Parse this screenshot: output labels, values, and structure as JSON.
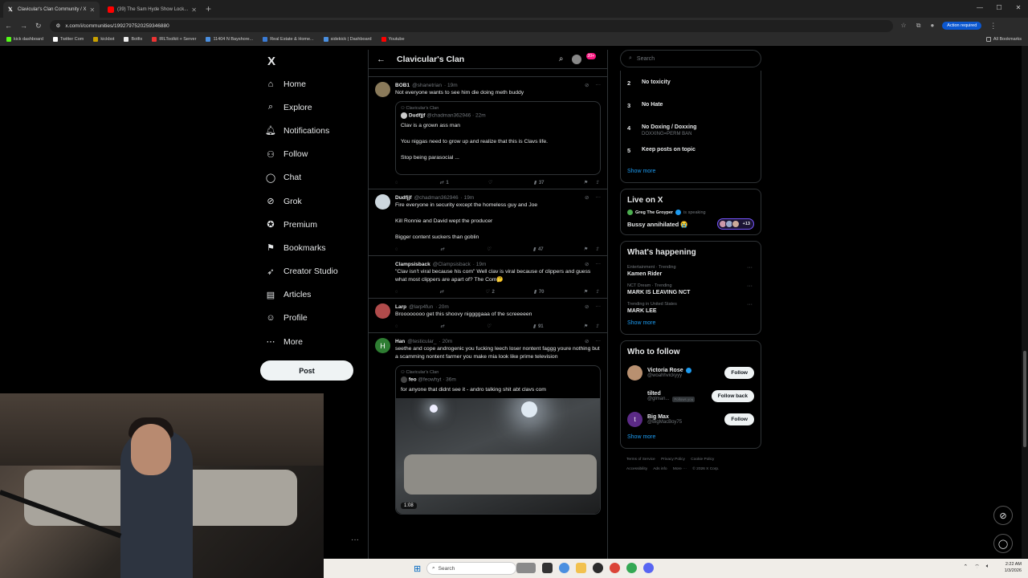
{
  "browser": {
    "tabs": [
      {
        "title": "Clavicular's Clan Community / X",
        "active": true
      },
      {
        "title": "(39) The Sam Hyde Show Lock...",
        "active": false
      }
    ],
    "new_tab": "+",
    "url": "x.com/i/communities/1992797520259346880",
    "action_required": "Action required",
    "bookmarks": [
      "kick dashboard",
      "Twitter Com",
      "kickbot",
      "Botfix",
      "IRLToolkit + Server",
      "11404 N Bayshore...",
      "Real Estate & Home...",
      "sidekick | Dashboard",
      "Youtube"
    ],
    "all_bookmarks": "All Bookmarks"
  },
  "nav": {
    "logo": "X",
    "items": [
      "Home",
      "Explore",
      "Notifications",
      "Follow",
      "Chat",
      "Grok",
      "Premium",
      "Bookmarks",
      "Creator Studio",
      "Articles",
      "Profile",
      "More"
    ],
    "post": "Post",
    "more_dots": "···"
  },
  "feed": {
    "title": "Clavicular's Clan",
    "badge": "20+",
    "tweets": [
      {
        "name": "BOB1",
        "handle": "@shanetrian",
        "time": "· 19m",
        "text": [
          "Not everyone wants to see him die doing meth buddy"
        ],
        "quote": {
          "community": "Clavicular's Clan",
          "name": "Dudfjjf",
          "handle": "@chadman362946",
          "time": "· 22m",
          "text": [
            "Clav is a grown ass man",
            "You niggas need to grow up and realize that this is Clavs life.",
            "Stop being parasocial ..."
          ]
        },
        "actions": {
          "reply": "",
          "repost": "1",
          "like": "",
          "views": "37"
        }
      },
      {
        "name": "Dudfjjf",
        "handle": "@chadman362946",
        "time": "· 19m",
        "text": [
          "Fire everyone in security except the homeless guy and Joe",
          "Kill Ronnie and David wept the producer",
          "Bigger content suckers than goblin"
        ],
        "actions": {
          "reply": "",
          "repost": "",
          "like": "",
          "views": "47"
        }
      },
      {
        "name": "Clampsisback",
        "handle": "@Clampsisback",
        "time": "· 19m",
        "text": [
          "\"Clav isn't viral because his com\" Well clav is viral because of clippers and guess what most clippers are apart of? The Com🤔"
        ],
        "actions": {
          "reply": "",
          "repost": "",
          "like": "2",
          "views": "70"
        }
      },
      {
        "name": "Larp",
        "handle": "@larp4fun",
        "time": "· 20m",
        "text": [
          "Broooooooo get this shoovy niggggaaa of the screeeeen"
        ],
        "actions": {
          "reply": "",
          "repost": "",
          "like": "",
          "views": "91"
        }
      },
      {
        "name": "Han",
        "handle": "@testicular_",
        "time": "· 20m",
        "avatar_letter": "H",
        "text": [
          "seethe and cope androgenic you fucking leech loser nontent faggg youre nothing but a scamming nontent farmer you make mia look like prime television"
        ],
        "quote": {
          "community": "Clavicular's Clan",
          "name": "feo",
          "handle": "@feowhyt",
          "time": "· 36m",
          "text": [
            "for anyone that didnt see it - andro talking shit abt clavs com"
          ]
        },
        "video_duration": "1:08"
      }
    ]
  },
  "right": {
    "search_placeholder": "Search",
    "rules": [
      {
        "num": "2",
        "title": "No toxicity",
        "desc": ""
      },
      {
        "num": "3",
        "title": "No Hate",
        "desc": ""
      },
      {
        "num": "4",
        "title": "No Doxing / Doxxing",
        "desc": "DOXXING=PERM BAN"
      },
      {
        "num": "5",
        "title": "Keep posts on topic",
        "desc": ""
      }
    ],
    "show_more": "Show more",
    "live": {
      "heading": "Live on X",
      "host": "Greg The Groyper",
      "host_status": "is speaking",
      "title": "Bussy annihilated 😭",
      "listeners": "+13"
    },
    "happening": {
      "heading": "What's happening",
      "trends": [
        {
          "context": "Entertainment · Trending",
          "name": "Kamen Rider"
        },
        {
          "context": "NCT Dream · Trending",
          "name": "MARK IS LEAVING NCT"
        },
        {
          "context": "Trending in United States",
          "name": "MARK LEE"
        }
      ]
    },
    "who_to_follow": {
      "heading": "Who to follow",
      "accounts": [
        {
          "name": "Victoria Rose",
          "handle": "@woahhvickyyy",
          "button": "Follow",
          "follows_you": ""
        },
        {
          "name": "tilted",
          "handle": "@glman...",
          "button": "Follow back",
          "follows_you": "Follows you"
        },
        {
          "name": "Big Max",
          "handle": "@BigMacBoy75",
          "button": "Follow",
          "follows_you": ""
        }
      ]
    },
    "footer": [
      "Terms of Service",
      "Privacy Policy",
      "Cookie Policy",
      "Accessibility",
      "Ads info",
      "More ···",
      "© 2026 X Corp."
    ]
  },
  "taskbar": {
    "search": "Search",
    "time": "2:22 AM",
    "date": "1/3/2026"
  },
  "colors": {
    "accent": "#1d9bf0",
    "border": "#2f3336",
    "muted": "#71767b",
    "text": "#e7e9ea"
  }
}
